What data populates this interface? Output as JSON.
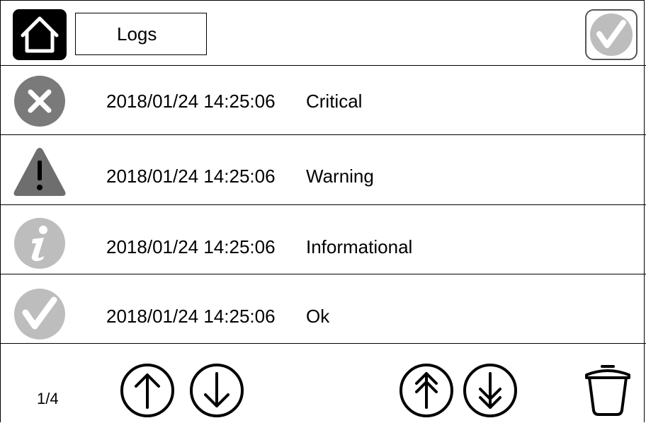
{
  "header": {
    "title": "Logs",
    "home_icon": "home-icon",
    "status_icon": "check-circle-icon"
  },
  "logs": [
    {
      "severity": "critical",
      "icon": "critical-x-icon",
      "time": "2018/01/24 14:25:06",
      "level": "Critical",
      "color": "#7a7a7a"
    },
    {
      "severity": "warning",
      "icon": "warning-triangle-icon",
      "time": "2018/01/24 14:25:06",
      "level": "Warning",
      "color": "#6e6e6e"
    },
    {
      "severity": "info",
      "icon": "info-icon",
      "time": "2018/01/24 14:25:06",
      "level": "Informational",
      "color": "#bdbdbd"
    },
    {
      "severity": "ok",
      "icon": "ok-check-icon",
      "time": "2018/01/24 14:25:06",
      "level": "Ok",
      "color": "#bdbdbd"
    }
  ],
  "footer": {
    "page_indicator": "1/4",
    "buttons": [
      "arrow-up-icon",
      "arrow-down-icon",
      "double-arrow-up-icon",
      "double-arrow-down-icon",
      "trash-icon"
    ]
  }
}
